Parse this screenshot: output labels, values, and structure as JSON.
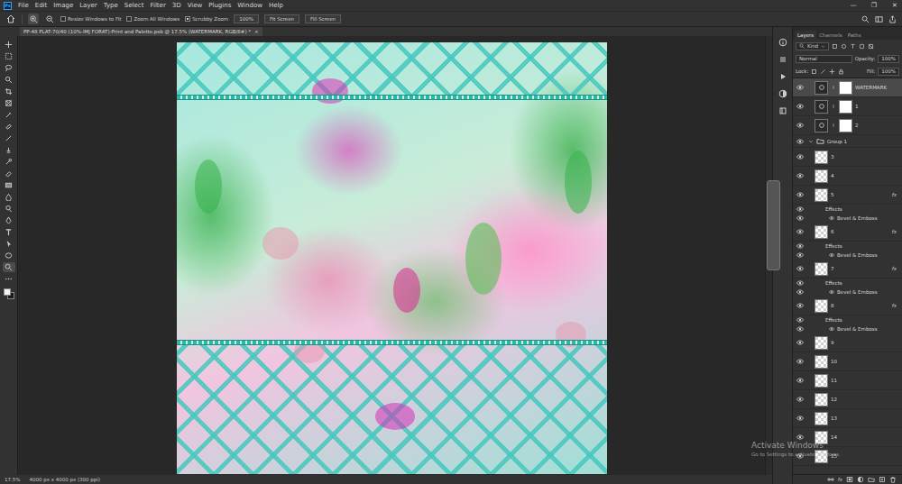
{
  "app": {
    "logo": "Ps"
  },
  "menu": [
    "File",
    "Edit",
    "Image",
    "Layer",
    "Type",
    "Select",
    "Filter",
    "3D",
    "View",
    "Plugins",
    "Window",
    "Help"
  ],
  "window_controls": [
    "—",
    "❐",
    "✕"
  ],
  "options": {
    "checkboxes": [
      {
        "label": "Resize Windows to Fit",
        "checked": false
      },
      {
        "label": "Zoom All Windows",
        "checked": false
      },
      {
        "label": "Scrubby Zoom",
        "checked": true
      }
    ],
    "buttons": [
      "100%",
      "Fit Screen",
      "Fill Screen"
    ]
  },
  "document_tab": {
    "title": "PP-48 PLAT-70/40 (10%-IMJ FORAT)-Print and Palette.psb @ 17.5% (WATERMARK, RGB/8#) *",
    "close": "×"
  },
  "toolbar": {
    "tools": [
      {
        "selected": false
      },
      {
        "selected": false
      },
      {
        "selected": false
      },
      {
        "selected": false
      },
      {
        "selected": false
      },
      {
        "selected": false
      },
      {
        "selected": false
      },
      {
        "selected": false
      },
      {
        "selected": false
      },
      {
        "selected": false
      },
      {
        "selected": false
      },
      {
        "selected": false
      },
      {
        "selected": false
      },
      {
        "selected": false
      },
      {
        "selected": false
      },
      {
        "selected": false
      },
      {
        "selected": false
      },
      {
        "selected": false
      },
      {
        "selected": false
      },
      {
        "selected": true
      },
      {
        "selected": false
      }
    ]
  },
  "status_bar": {
    "zoom": "17.5%",
    "info": "4000 px x 4000 px (300 ppi)"
  },
  "layers_panel": {
    "tabs": [
      {
        "label": "Layers",
        "selected": true
      },
      {
        "label": "Channels",
        "selected": false
      },
      {
        "label": "Paths",
        "selected": false
      }
    ],
    "filter": "Kind",
    "blend_mode": "Normal",
    "opacity_label": "Opacity:",
    "opacity": "100%",
    "lock_label": "Lock:",
    "fill_label": "Fill:",
    "fill": "100%",
    "layers": [
      {
        "kind": "layer",
        "name": "WATERMARK",
        "visible": true,
        "selected": true,
        "mask": true
      },
      {
        "kind": "layer",
        "name": "1",
        "visible": true,
        "selected": false,
        "mask": true
      },
      {
        "kind": "layer",
        "name": "2",
        "visible": true,
        "selected": false,
        "mask": true
      },
      {
        "kind": "group",
        "name": "Group 1",
        "visible": true,
        "selected": false,
        "expanded": true
      },
      {
        "kind": "layer",
        "name": "3",
        "visible": true,
        "selected": false,
        "mask": false
      },
      {
        "kind": "layer",
        "name": "4",
        "visible": true,
        "selected": false,
        "mask": false
      },
      {
        "kind": "layer",
        "name": "5",
        "visible": true,
        "selected": false,
        "mask": false,
        "badge": "fx"
      },
      {
        "kind": "effects",
        "name": "Effects",
        "visible": true
      },
      {
        "kind": "effect",
        "name": "Bevel & Emboss",
        "visible": true
      },
      {
        "kind": "layer",
        "name": "6",
        "visible": true,
        "selected": false,
        "mask": false,
        "badge": "fx"
      },
      {
        "kind": "effects",
        "name": "Effects",
        "visible": true
      },
      {
        "kind": "effect",
        "name": "Bevel & Emboss",
        "visible": true
      },
      {
        "kind": "layer",
        "name": "7",
        "visible": true,
        "selected": false,
        "mask": false,
        "badge": "fx"
      },
      {
        "kind": "effects",
        "name": "Effects",
        "visible": true
      },
      {
        "kind": "effect",
        "name": "Bevel & Emboss",
        "visible": true
      },
      {
        "kind": "layer",
        "name": "8",
        "visible": true,
        "selected": false,
        "mask": false,
        "badge": "fx"
      },
      {
        "kind": "effects",
        "name": "Effects",
        "visible": true
      },
      {
        "kind": "effect",
        "name": "Bevel & Emboss",
        "visible": true
      },
      {
        "kind": "layer",
        "name": "9",
        "visible": true,
        "selected": false,
        "mask": false
      },
      {
        "kind": "layer",
        "name": "10",
        "visible": true,
        "selected": false,
        "mask": false
      },
      {
        "kind": "layer",
        "name": "11",
        "visible": true,
        "selected": false,
        "mask": false
      },
      {
        "kind": "layer",
        "name": "12",
        "visible": true,
        "selected": false,
        "mask": false
      },
      {
        "kind": "layer",
        "name": "13",
        "visible": true,
        "selected": false,
        "mask": false
      },
      {
        "kind": "layer",
        "name": "14",
        "visible": true,
        "selected": false,
        "mask": false
      },
      {
        "kind": "layer",
        "name": "15",
        "visible": true,
        "selected": false,
        "mask": false
      }
    ],
    "footer": [
      "fx"
    ]
  },
  "notice": {
    "title": "Activate Windows",
    "text": "Go to Settings to activate Windows."
  }
}
